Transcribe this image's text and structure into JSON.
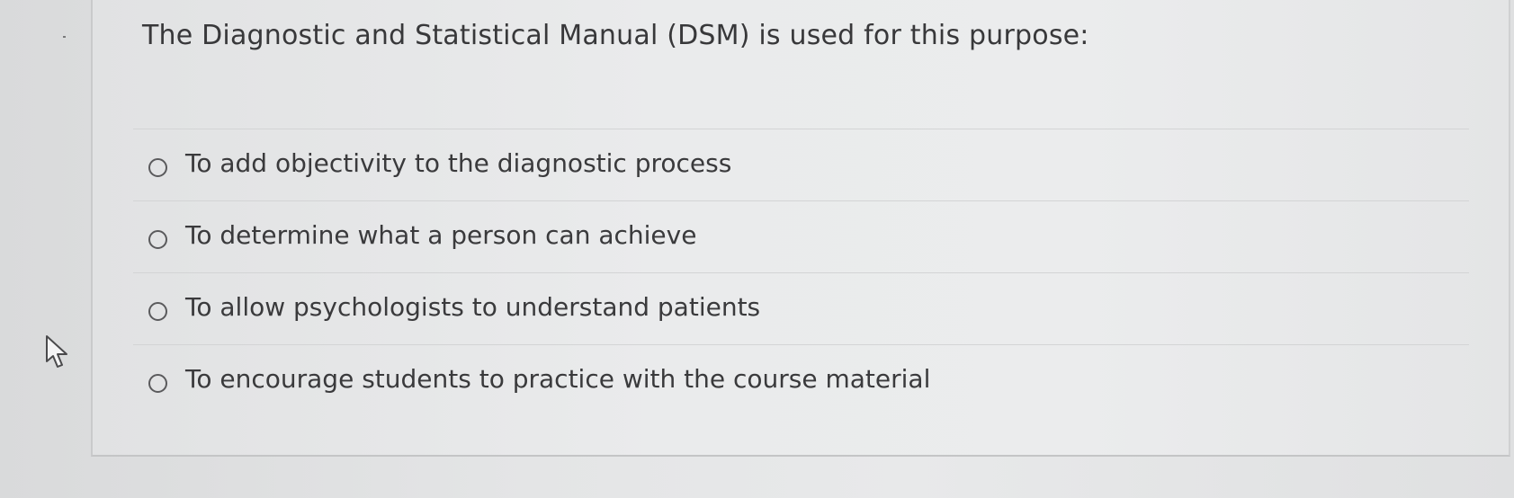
{
  "question": {
    "text": "The Diagnostic and Statistical Manual (DSM) is used for this purpose:"
  },
  "options": [
    {
      "label": "To add objectivity to the diagnostic process"
    },
    {
      "label": "To determine what a person can achieve"
    },
    {
      "label": "To allow psychologists to understand patients"
    },
    {
      "label": "To encourage students to practice with the course material"
    }
  ],
  "icons": {
    "cursor": "mouse-pointer-icon",
    "radio": "radio-unselected-icon"
  },
  "colors": {
    "text": "#3a3a3c",
    "background": "#e6e7e8",
    "divider": "#d3d4d5"
  }
}
